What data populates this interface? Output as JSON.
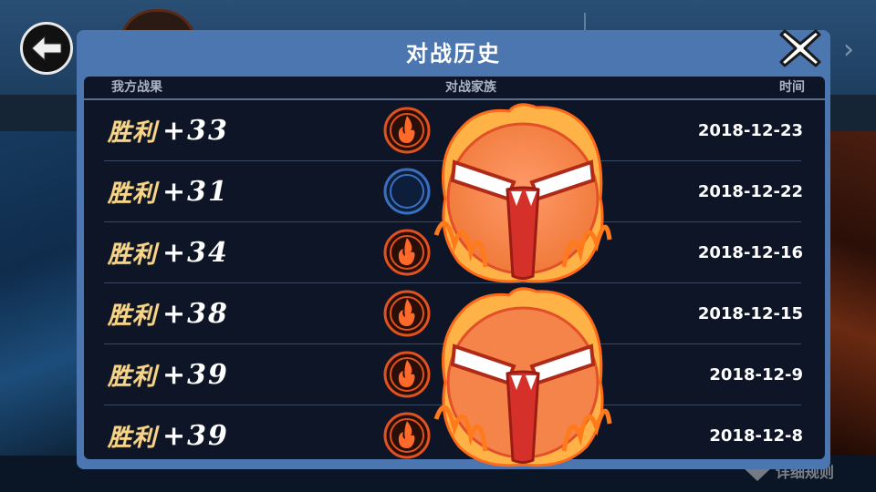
{
  "dialog": {
    "title": "对战历史",
    "columns": {
      "result": "我方战果",
      "clan": "对战家族",
      "time": "时间"
    }
  },
  "rows": [
    {
      "result_word": "胜利",
      "score": "+33",
      "clan_icon": "fire-clan-icon",
      "clan_name": "",
      "date": "2018-12-23"
    },
    {
      "result_word": "胜利",
      "score": "+31",
      "clan_icon": "moon-clan-icon",
      "clan_name": "",
      "date": "2018-12-22"
    },
    {
      "result_word": "胜利",
      "score": "+34",
      "clan_icon": "fire-clan-icon",
      "clan_name": "",
      "date": "2018-12-16"
    },
    {
      "result_word": "胜利",
      "score": "+38",
      "clan_icon": "fire-clan-icon",
      "clan_name": "",
      "date": "2018-12-15"
    },
    {
      "result_word": "胜利",
      "score": "+39",
      "clan_icon": "fire-clan-icon",
      "clan_name": "",
      "date": "2018-12-9"
    },
    {
      "result_word": "胜利",
      "score": "+39",
      "clan_icon": "fire-clan-icon",
      "clan_name": "",
      "date": "2018-12-8"
    }
  ],
  "footer": {
    "rules_label": "详细规则"
  },
  "icons": {
    "back": "back-arrow-icon",
    "close": "close-x-icon",
    "next": "chevron-right-icon",
    "overlay": "angry-fire-face-sticker"
  },
  "colors": {
    "modal_frame": "#4b76b0",
    "panel_bg": "#0e1527",
    "win_text": "#f6d58a",
    "fire_icon": "#e0521f",
    "moon_icon": "#3a6fc0"
  }
}
